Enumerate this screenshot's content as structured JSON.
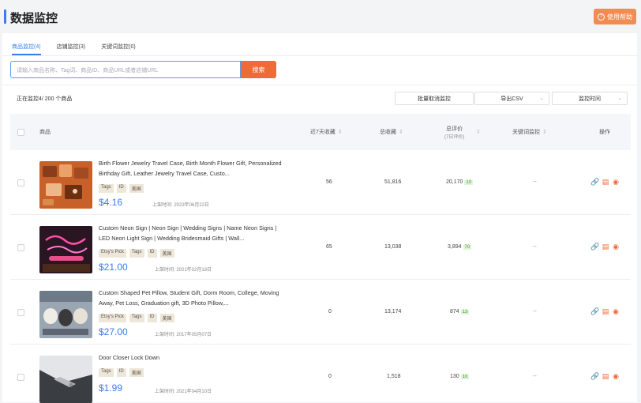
{
  "header": {
    "title": "数据监控",
    "help_label": "使用帮助",
    "help_icon": "question-circle-icon",
    "accent_color": "#3b7ded",
    "brand_color": "#f06a35"
  },
  "tabs": [
    {
      "label": "商品监控(4)"
    },
    {
      "label": "店铺监控(3)"
    },
    {
      "label": "关键词监控(0)"
    }
  ],
  "search": {
    "placeholder": "请输入商品名称、Tag词、商品ID、商品URL或者店铺URL",
    "button_label": "搜索"
  },
  "toolbar": {
    "summary": "正在监控4/ 200 个商品",
    "batch_cancel_label": "批量取消监控",
    "export_label": "导出CSV",
    "sort_label": "监控时间"
  },
  "table": {
    "columns": {
      "product": "商品",
      "fav_count": "近7天收藏",
      "total_fav": "总收藏",
      "reviews": "总评价",
      "reviews_sub": "(7日评价)",
      "keywords": "关键词监控",
      "actions": "操作"
    },
    "rows": [
      {
        "title": "Birth Flower Jewelry Travel Case, Birth Month Flower Gift, Personalized Birthday Gift, Leather Jewelry Travel Case, Custo...",
        "tags": [
          "Tags",
          "ID",
          "美国"
        ],
        "price": "$4.16",
        "date": "上架时间: 2023年06月22日",
        "fav_count": "56",
        "total_fav": "51,816",
        "reviews": "20,170",
        "reviews_7d": "10",
        "keywords": "--"
      },
      {
        "title": "Custom Neon Sign | Neon Sign | Wedding Signs | Name Neon Signs | LED Neon Light Sign | Wedding Bridesmaid Gifts | Wall...",
        "tags": [
          "Etsy's Pick",
          "Tags",
          "ID",
          "美国"
        ],
        "price": "$21.00",
        "date": "上架时间: 2021年02月18日",
        "fav_count": "65",
        "total_fav": "13,038",
        "reviews": "3,894",
        "reviews_7d": "70",
        "keywords": "--"
      },
      {
        "title": "Custom Shaped Pet Pillow, Student Gift, Dorm Room, College, Moving Away, Pet Loss, Graduation gift, 3D Photo Pillow,...",
        "tags": [
          "Etsy's Pick",
          "Tags",
          "ID",
          "美国"
        ],
        "price": "$27.00",
        "date": "上架时间: 2017年05月07日",
        "fav_count": "0",
        "total_fav": "13,174",
        "reviews": "874",
        "reviews_7d": "13",
        "keywords": "--"
      },
      {
        "title": "Door Closer Lock Down",
        "tags": [
          "Tags",
          "ID",
          "美国"
        ],
        "price": "$1.99",
        "date": "上架时间: 2021年04月10日",
        "fav_count": "0",
        "total_fav": "1,518",
        "reviews": "130",
        "reviews_7d": "10",
        "keywords": "--"
      }
    ],
    "action_icons": [
      "link-icon",
      "report-icon",
      "stop-monitor-icon"
    ]
  }
}
